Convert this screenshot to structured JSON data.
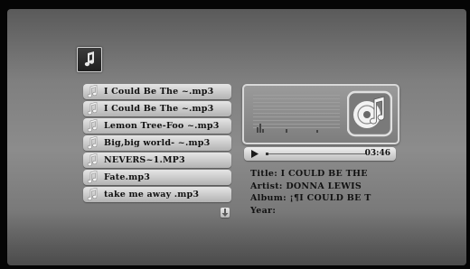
{
  "playlist": {
    "items": [
      {
        "label": "I Could Be The ~.mp3"
      },
      {
        "label": "I Could Be The ~.mp3"
      },
      {
        "label": "Lemon Tree-Foo ~.mp3"
      },
      {
        "label": "Big,big world- ~.mp3"
      },
      {
        "label": "NEVERS~1.MP3"
      },
      {
        "label": "Fate.mp3"
      },
      {
        "label": "take me away .mp3"
      }
    ]
  },
  "player": {
    "time": "03:46",
    "progress": 0.03
  },
  "track_info": {
    "title_line": "Title: I COULD BE THE",
    "artist_line": "Artist: DONNA LEWIS",
    "album_line": "Album: ¡¶I COULD BE T",
    "year_line": "Year:"
  },
  "icons": {
    "app": "music-note-icon",
    "list_item": "music-note-icon",
    "art": "music-disc-icon",
    "play": "play-icon",
    "scroll": "scroll-down-arrow-icon"
  }
}
